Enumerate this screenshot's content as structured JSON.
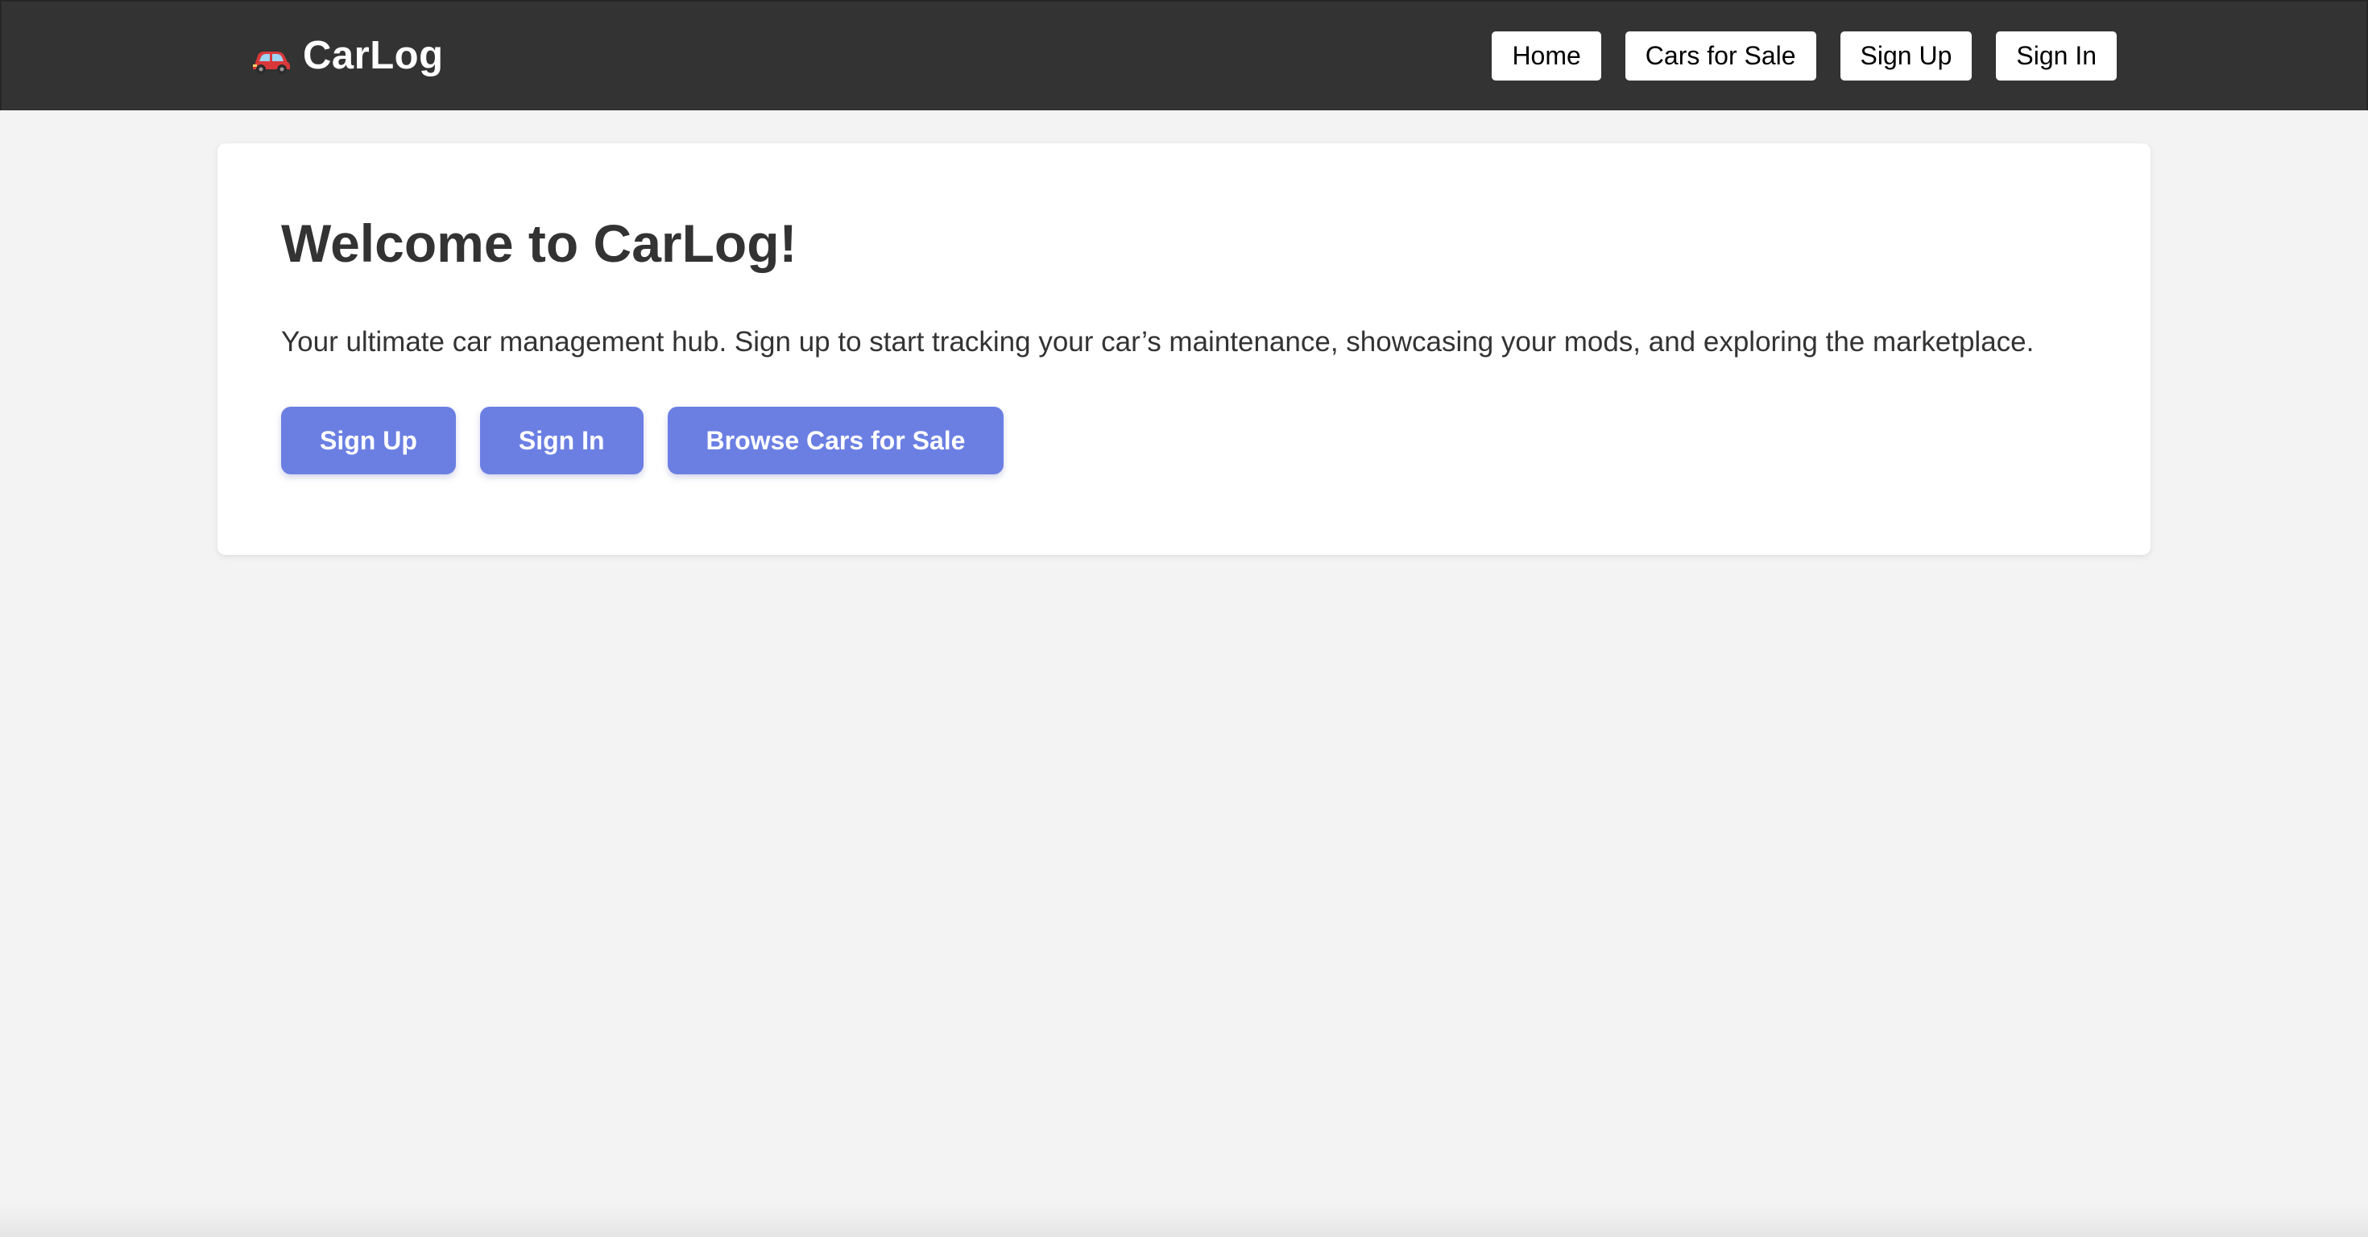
{
  "header": {
    "brand_icon": "car-icon",
    "brand_name": "CarLog",
    "nav": {
      "home": "Home",
      "cars_for_sale": "Cars for Sale",
      "sign_up": "Sign Up",
      "sign_in": "Sign In"
    }
  },
  "hero": {
    "title": "Welcome to CarLog!",
    "description": "Your ultimate car management hub. Sign up to start tracking your car’s maintenance, showcasing your mods, and exploring the marketplace.",
    "buttons": {
      "sign_up": "Sign Up",
      "sign_in": "Sign In",
      "browse": "Browse Cars for Sale"
    }
  },
  "colors": {
    "header_bg": "#333333",
    "page_bg": "#f3f3f3",
    "accent": "#6b7fe3",
    "car_red": "#d9383a"
  }
}
